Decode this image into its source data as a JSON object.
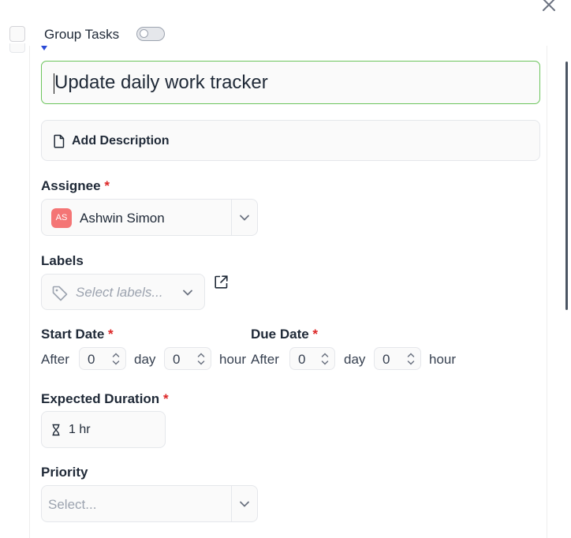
{
  "header": {
    "group_tasks_label": "Group Tasks",
    "group_tasks_enabled": false
  },
  "task": {
    "title": "Update daily work tracker",
    "add_description_label": "Add Description"
  },
  "assignee": {
    "label": "Assignee",
    "required_mark": "*",
    "initials": "AS",
    "name": "Ashwin Simon",
    "avatar_color": "#f47575"
  },
  "labels": {
    "label": "Labels",
    "placeholder": "Select labels..."
  },
  "start_date": {
    "label": "Start Date",
    "required_mark": "*",
    "prefix": "After",
    "days": "0",
    "day_unit": "day",
    "hours": "0",
    "hour_unit": "hour"
  },
  "due_date": {
    "label": "Due Date",
    "required_mark": "*",
    "prefix": "After",
    "days": "0",
    "day_unit": "day",
    "hours": "0",
    "hour_unit": "hour"
  },
  "expected_duration": {
    "label": "Expected Duration",
    "required_mark": "*",
    "value": "1 hr"
  },
  "priority": {
    "label": "Priority",
    "placeholder": "Select..."
  },
  "colors": {
    "focus_border": "#6cc45c",
    "required": "#dc2626",
    "accent": "#2b4bd6"
  },
  "icons": [
    "close-icon",
    "document-icon",
    "chevron-down-icon",
    "tag-icon",
    "external-link-icon",
    "hourglass-icon",
    "spinner-arrows-icon"
  ]
}
